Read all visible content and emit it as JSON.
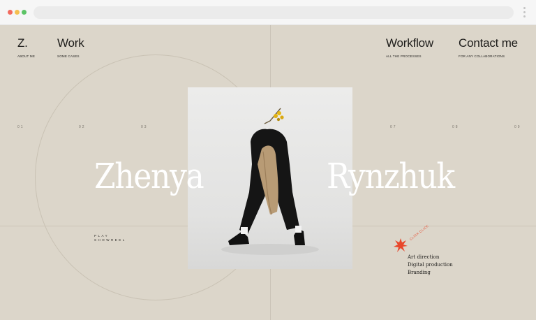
{
  "nav": {
    "logo": {
      "label": "Z.",
      "sub": "ABOUT ME"
    },
    "work": {
      "label": "Work",
      "sub": "SOME CASES"
    },
    "workflow": {
      "label": "Workflow",
      "sub": "ALL THE PROCESSES"
    },
    "contact": {
      "label": "Contact me",
      "sub": "FOR ANY COLLABORATIONS"
    }
  },
  "numbers": [
    "01",
    "02",
    "03",
    "07",
    "08",
    "09"
  ],
  "hero": {
    "first_name": "Zhenya",
    "last_name": "Rynzhuk"
  },
  "showreel": {
    "line1": "PLAY",
    "line2": "SHOWREEL"
  },
  "click_badge": "CLICK CLICK",
  "services": [
    "Art direction",
    "Digital production",
    "Branding"
  ],
  "colors": {
    "background": "#dcd6ca",
    "text": "#1d1c1a",
    "accent": "#e8472b",
    "hero_text": "#ffffff"
  }
}
